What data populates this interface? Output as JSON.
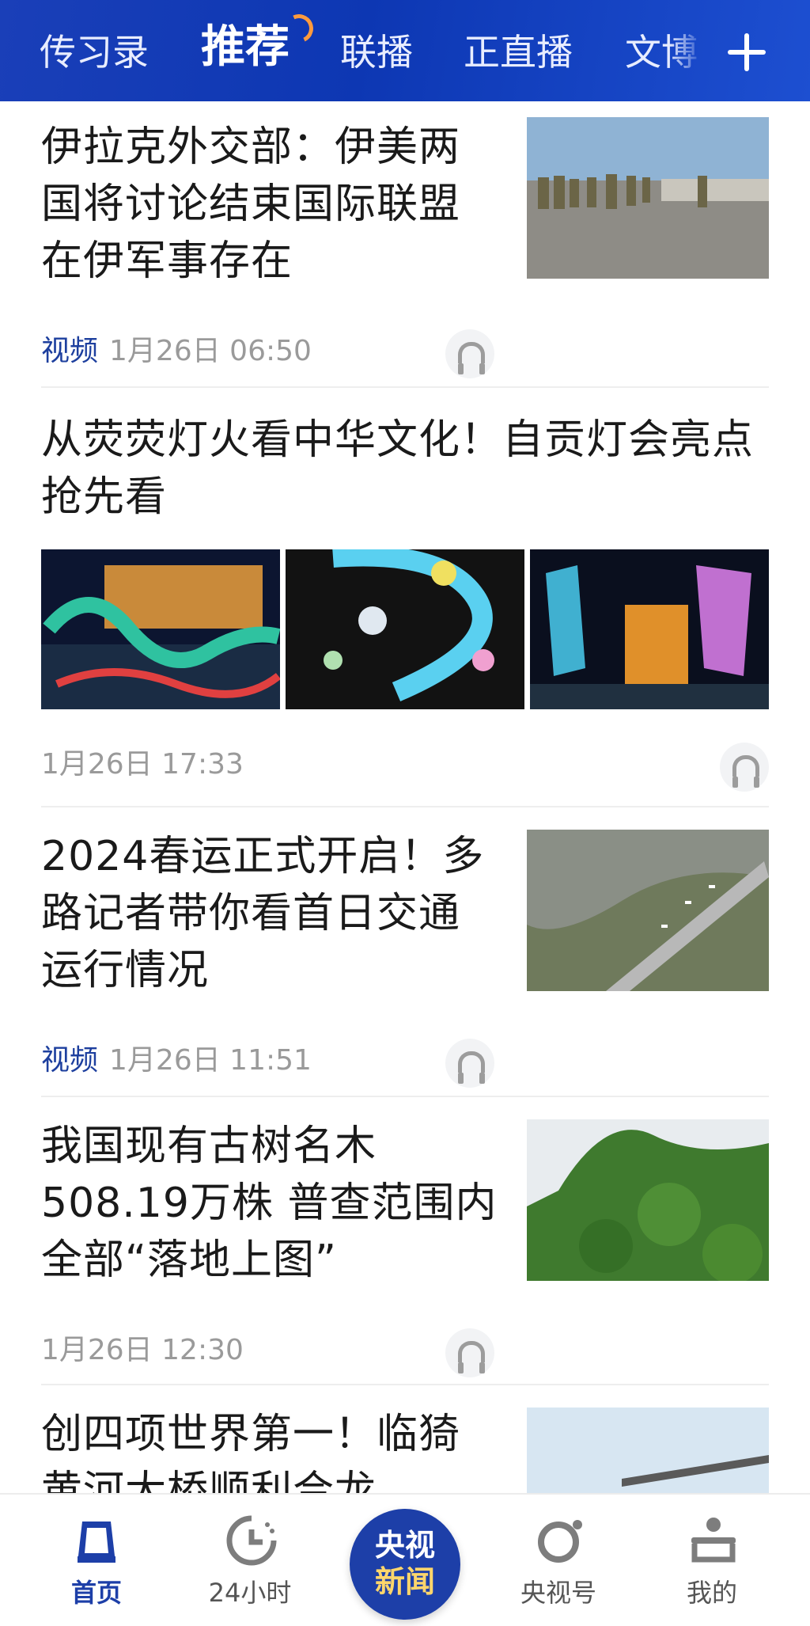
{
  "top_tabs": [
    "传习录",
    "推荐",
    "联播",
    "正直播",
    "文博"
  ],
  "active_tab": "推荐",
  "colors": {
    "brand_blue": "#0d37b3",
    "tag_blue": "#1d3f9e",
    "hot_orange": "#ff9a3d",
    "meta_gray": "#9a9a9a"
  },
  "feed": [
    {
      "title": "伊拉克外交部：伊美两国将讨论结束国际联盟在伊军事存在",
      "tag": "视频",
      "time": "1月26日 06:50"
    },
    {
      "title": "从荧荧灯火看中华文化！自贡灯会亮点抢先看",
      "tag": "",
      "time": "1月26日 17:33"
    },
    {
      "title": "2024春运正式开启！多路记者带你看首日交通运行情况",
      "tag": "视频",
      "time": "1月26日 11:51"
    },
    {
      "title": "我国现有古树名木508.19万株 普查范围内全部“落地上图”",
      "tag": "",
      "time": "1月26日 12:30"
    },
    {
      "title": "创四项世界第一！临猗黄河大桥顺利合龙",
      "tag": "",
      "time": ""
    }
  ],
  "bottom_nav": [
    {
      "label": "首页",
      "icon": "home-icon",
      "active": true
    },
    {
      "label": "24小时",
      "icon": "clock-icon",
      "active": false
    },
    {
      "label_line1": "央视",
      "label_line2": "新闻",
      "icon": "cctv-news-logo"
    },
    {
      "label": "央视号",
      "icon": "channel-icon",
      "active": false
    },
    {
      "label": "我的",
      "icon": "profile-icon",
      "active": false
    }
  ]
}
